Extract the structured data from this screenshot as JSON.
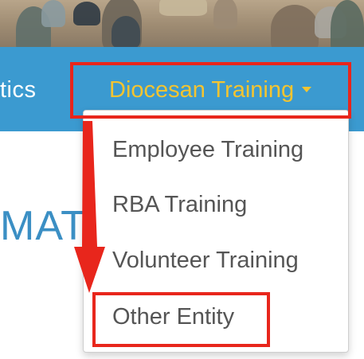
{
  "navbar": {
    "partial_item_label": "tics",
    "dropdown_label": "Diocesan Training",
    "dropdown_caret": "caret-down-icon",
    "colors": {
      "background": "#3b9ad0",
      "text": "#ffffff",
      "dropdown_text": "#f4c430"
    }
  },
  "page": {
    "heading_partial": "MAT",
    "heading_color": "#3b8fc4"
  },
  "dropdown_menu": {
    "items": [
      {
        "label": "Employee Training"
      },
      {
        "label": "RBA Training"
      },
      {
        "label": "Volunteer Training"
      },
      {
        "label": "Other Entity"
      }
    ]
  },
  "annotations": {
    "highlight_color": "#e8261c",
    "arrow_color": "#e8261c"
  }
}
